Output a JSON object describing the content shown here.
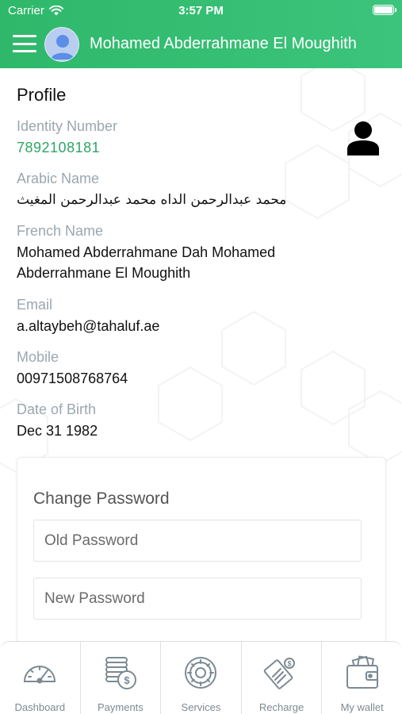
{
  "status_bar": {
    "carrier": "Carrier",
    "time": "3:57 PM"
  },
  "header": {
    "user_name": "Mohamed Abderrahmane El Moughith"
  },
  "profile": {
    "title": "Profile",
    "identity_label": "Identity Number",
    "identity_value": "7892108181",
    "arabic_label": "Arabic Name",
    "arabic_value": "محمد عبدالرحمن الداه محمد عبدالرحمن المغيث",
    "french_label": "French Name",
    "french_value_line1": "Mohamed Abderrahmane Dah Mohamed",
    "french_value_line2": "Abderrahmane El Moughith",
    "email_label": "Email",
    "email_value": "a.altaybeh@tahaluf.ae",
    "mobile_label": "Mobile",
    "mobile_value": "00971508768764",
    "dob_label": "Date of Birth",
    "dob_value": "Dec 31 1982"
  },
  "change_password": {
    "title": "Change Password",
    "old_placeholder": "Old Password",
    "new_placeholder": "New Password"
  },
  "tabs": [
    {
      "label": "Dashboard",
      "icon": "speedometer-icon"
    },
    {
      "label": "Payments",
      "icon": "coins-icon"
    },
    {
      "label": "Services",
      "icon": "gear-icon"
    },
    {
      "label": "Recharge",
      "icon": "recharge-card-icon"
    },
    {
      "label": "My wallet",
      "icon": "wallet-icon"
    }
  ],
  "colors": {
    "header_green": "#3cc47c",
    "identity_green": "#2ea566",
    "label_gray": "#9aa7b0"
  }
}
